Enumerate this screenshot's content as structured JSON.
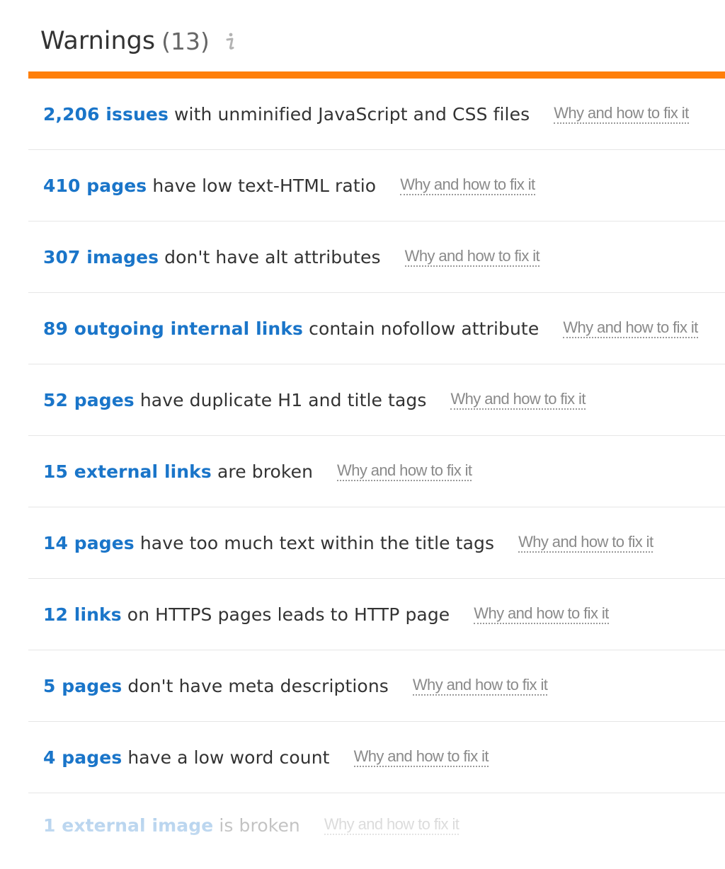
{
  "header": {
    "title": "Warnings",
    "count": "(13)",
    "info_icon": "info-icon"
  },
  "colors": {
    "accent_bar": "#ff7f0a",
    "count_blue": "#1a75c9",
    "text": "#333333",
    "link_gray": "#8a8a8a"
  },
  "warnings": [
    {
      "count": "2,206 issues",
      "text": " with unminified JavaScript and CSS files",
      "link": "Why and how to fix it"
    },
    {
      "count": "410 pages",
      "text": " have low text-HTML ratio",
      "link": "Why and how to fix it"
    },
    {
      "count": "307 images",
      "text": " don't have alt attributes",
      "link": "Why and how to fix it"
    },
    {
      "count": "89 outgoing internal links",
      "text": " contain nofollow attribute",
      "link": "Why and how to fix it"
    },
    {
      "count": "52 pages",
      "text": " have duplicate H1 and title tags",
      "link": "Why and how to fix it"
    },
    {
      "count": "15 external links",
      "text": " are broken",
      "link": "Why and how to fix it"
    },
    {
      "count": "14 pages",
      "text": " have too much text within the title tags",
      "link": "Why and how to fix it"
    },
    {
      "count": "12 links",
      "text": " on HTTPS pages leads to HTTP page",
      "link": "Why and how to fix it"
    },
    {
      "count": "5 pages",
      "text": " don't have meta descriptions",
      "link": "Why and how to fix it"
    },
    {
      "count": "4 pages",
      "text": " have a low word count",
      "link": "Why and how to fix it"
    },
    {
      "count": "1 external image",
      "text": " is broken",
      "link": "Why and how to fix it"
    }
  ]
}
